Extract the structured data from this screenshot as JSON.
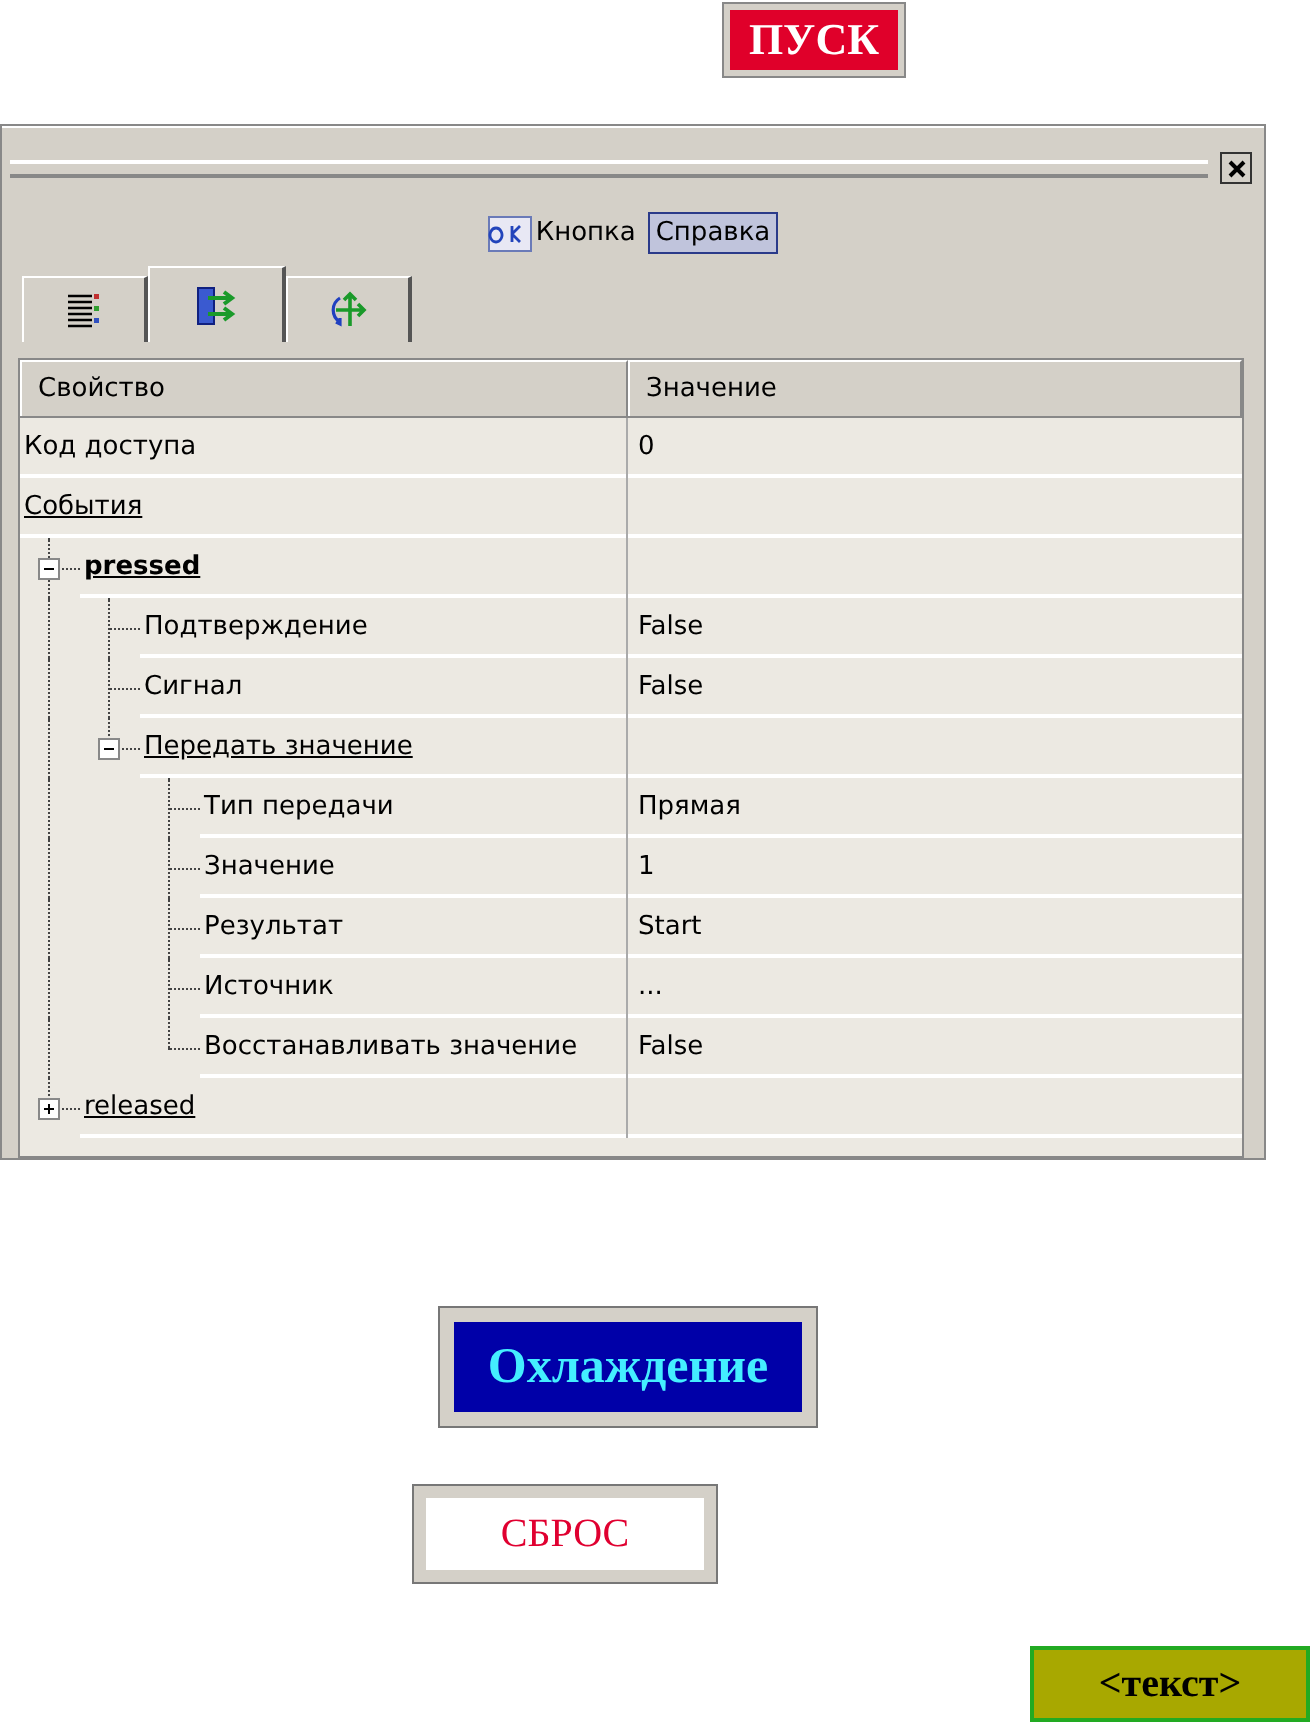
{
  "start_button": {
    "label": "ПУСК"
  },
  "panel": {
    "element_type": "Кнопка",
    "help_button": "Справка",
    "tabs": [
      {
        "kind": "list",
        "selected": false
      },
      {
        "kind": "events",
        "selected": true
      },
      {
        "kind": "transform",
        "selected": false
      }
    ],
    "columns": [
      "Свойство",
      "Значение"
    ],
    "properties": [
      {
        "name": "Код доступа",
        "value": "0"
      },
      {
        "name": "События",
        "kind": "group",
        "children": [
          {
            "name": "pressed",
            "kind": "group",
            "selected": true,
            "expanded": true,
            "children": [
              {
                "name": "Подтверждение",
                "value": "False"
              },
              {
                "name": "Сигнал",
                "value": "False"
              },
              {
                "name": "Передать значение",
                "kind": "group",
                "expanded": true,
                "children": [
                  {
                    "name": "Тип передачи",
                    "value": "Прямая"
                  },
                  {
                    "name": "Значение",
                    "value": "1"
                  },
                  {
                    "name": "Результат",
                    "value": "Start"
                  },
                  {
                    "name": "Источник",
                    "value": "..."
                  },
                  {
                    "name": "Восстанавливать значение",
                    "value": "False"
                  }
                ]
              }
            ]
          },
          {
            "name": "released",
            "kind": "group",
            "selected": false,
            "expanded": false
          }
        ]
      }
    ]
  },
  "cooling_button": {
    "label": "Охлаждение"
  },
  "reset_button": {
    "label": "СБРОС"
  },
  "text_button": {
    "label": "<текст>"
  }
}
